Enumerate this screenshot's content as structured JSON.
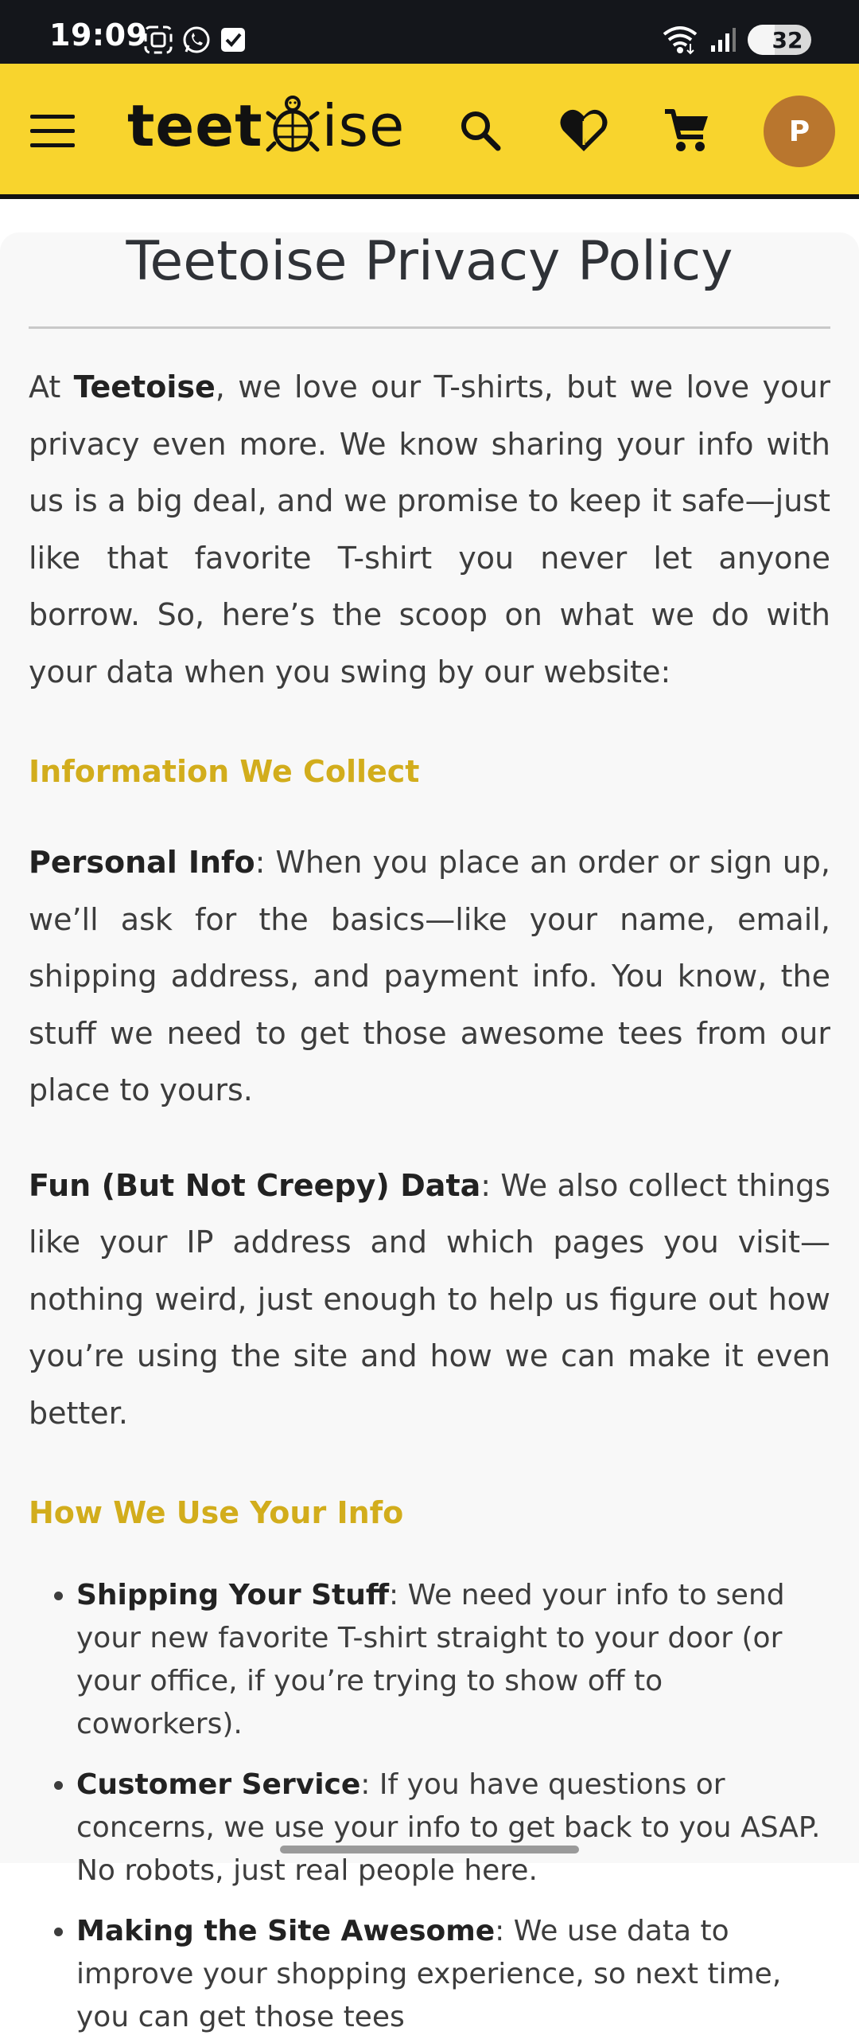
{
  "status_bar": {
    "time": "19:09",
    "battery": "32",
    "icons_left": [
      "screenshot-icon",
      "whatsapp-icon",
      "checkbox-notification-icon"
    ],
    "icons_right": [
      "wifi-icon",
      "signal-icon",
      "battery-icon"
    ]
  },
  "header": {
    "logo_text_start": "teet",
    "logo_text_end": "ise",
    "avatar_letter": "P",
    "icons": [
      "menu-icon",
      "search-icon",
      "heart-icon",
      "cart-icon"
    ]
  },
  "page": {
    "title": "Teetoise Privacy Policy",
    "intro_prefix": "At ",
    "intro_brand": "Teetoise",
    "intro_rest": ", we love our T-shirts, but we love your privacy even more. We know sharing your info with us is a big deal, and we promise to keep it safe—just like that favorite T-shirt you never let anyone borrow. So, here’s the scoop on what we do with your data when you swing by our website:",
    "section1_title": "Information We Collect",
    "personal_label": "Personal Info",
    "personal_text": ": When you place an order or sign up, we’ll ask for the basics—like your name, email, shipping address, and payment info. You know, the stuff we need to get those awesome tees from our place to yours.",
    "fun_label": "Fun (But Not Creepy) Data",
    "fun_text": ": We also collect things like your IP address and which pages you visit—nothing weird, just enough to help us figure out how you’re using the site and how we can make it even better.",
    "section2_title": "How We Use Your Info",
    "bullets": [
      {
        "label": "Shipping Your Stuff",
        "text": ": We need your info to send your new favorite T-shirt straight to your door (or your office, if you’re trying to show off to coworkers)."
      },
      {
        "label": "Customer Service",
        "text": ": If you have questions or concerns, we use your info to get back to you ASAP. No robots, just real people here."
      },
      {
        "label": "Making the Site Awesome",
        "text": ": We use data to improve your shopping experience, so next time, you can get those tees"
      }
    ]
  }
}
